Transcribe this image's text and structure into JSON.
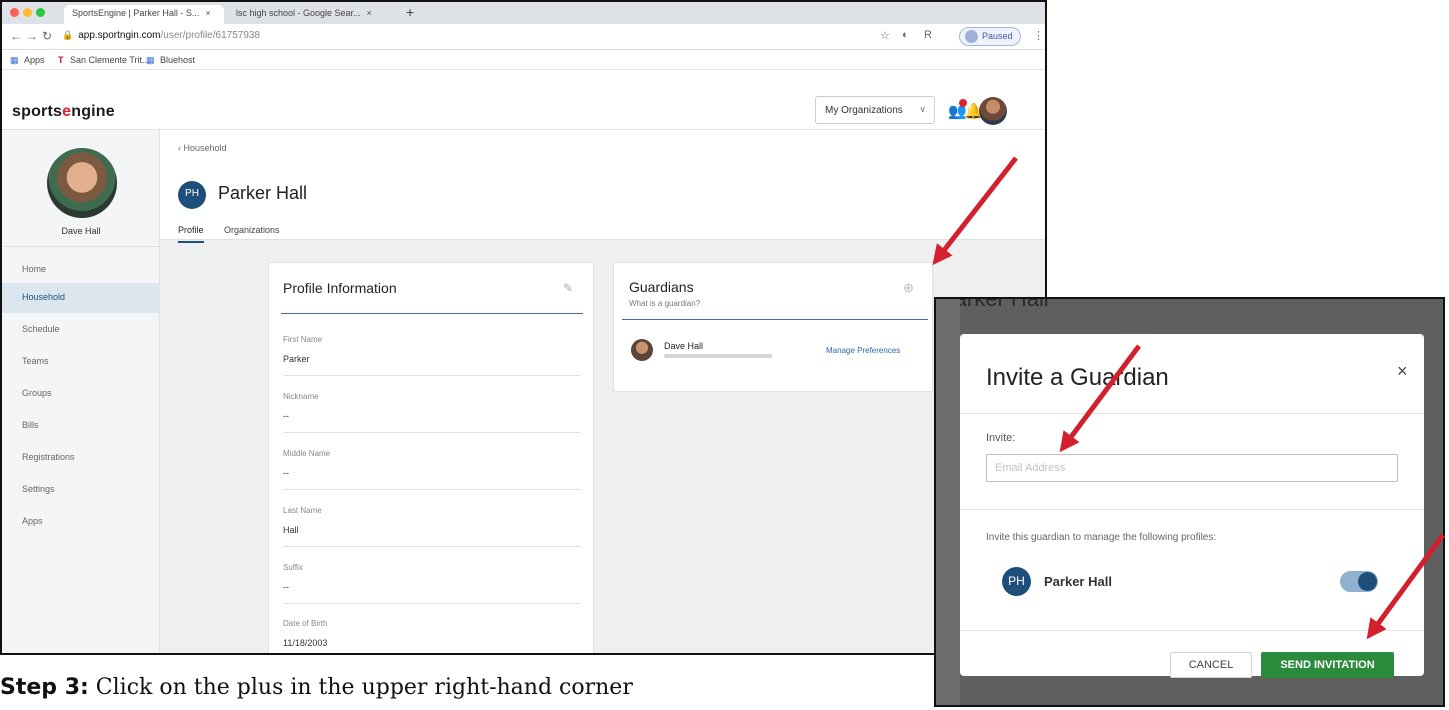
{
  "browser": {
    "tabs": [
      {
        "label": "SportsEngine | Parker Hall - S..."
      },
      {
        "label": "lsc high school - Google Sear..."
      }
    ],
    "new_tab": "+",
    "url_host": "app.sportngin.com",
    "url_path": "/user/profile/61757938",
    "paused_label": "Paused",
    "bookmarks": [
      {
        "label": "Apps"
      },
      {
        "label": "San Clemente Trit..."
      },
      {
        "label": "Bluehost"
      }
    ]
  },
  "app": {
    "logo_pre": "sports",
    "logo_e": "e",
    "logo_post": "ngine",
    "org_dropdown": "My Organizations",
    "user_name": "Dave Hall",
    "sidebar": [
      {
        "label": "Home"
      },
      {
        "label": "Household"
      },
      {
        "label": "Schedule"
      },
      {
        "label": "Teams"
      },
      {
        "label": "Groups"
      },
      {
        "label": "Bills"
      },
      {
        "label": "Registrations"
      },
      {
        "label": "Settings"
      },
      {
        "label": "Apps"
      }
    ],
    "breadcrumb": "Household",
    "profile_initials": "PH",
    "profile_name": "Parker Hall",
    "subtabs": [
      {
        "label": "Profile"
      },
      {
        "label": "Organizations"
      }
    ],
    "profile_card": {
      "title": "Profile Information",
      "fields": [
        {
          "label": "First Name",
          "value": "Parker"
        },
        {
          "label": "Nickname",
          "value": "--"
        },
        {
          "label": "Middle Name",
          "value": "--"
        },
        {
          "label": "Last Name",
          "value": "Hall"
        },
        {
          "label": "Suffix",
          "value": "--"
        },
        {
          "label": "Date of Birth",
          "value": "11/18/2003"
        }
      ]
    },
    "guardians_card": {
      "title": "Guardians",
      "subtitle": "What is a guardian?",
      "guardian_name": "Dave Hall",
      "manage_link": "Manage Preferences"
    }
  },
  "caption": {
    "step": "Step 3:",
    "text": "Click on the plus in the upper right-hand corner"
  },
  "modal": {
    "bg_heading": "Parker Hall",
    "title": "Invite a Guardian",
    "close": "×",
    "invite_label": "Invite:",
    "email_placeholder": "Email Address",
    "manage_text": "Invite this guardian to manage the following profiles:",
    "profile_initials": "PH",
    "profile_name": "Parker Hall",
    "toggle_on": true,
    "cancel_label": "CANCEL",
    "send_label": "SEND INVITATION"
  },
  "colors": {
    "arrow": "#d4202c",
    "brand_blue": "#1d4f7a",
    "send_green": "#2c8a3d"
  }
}
